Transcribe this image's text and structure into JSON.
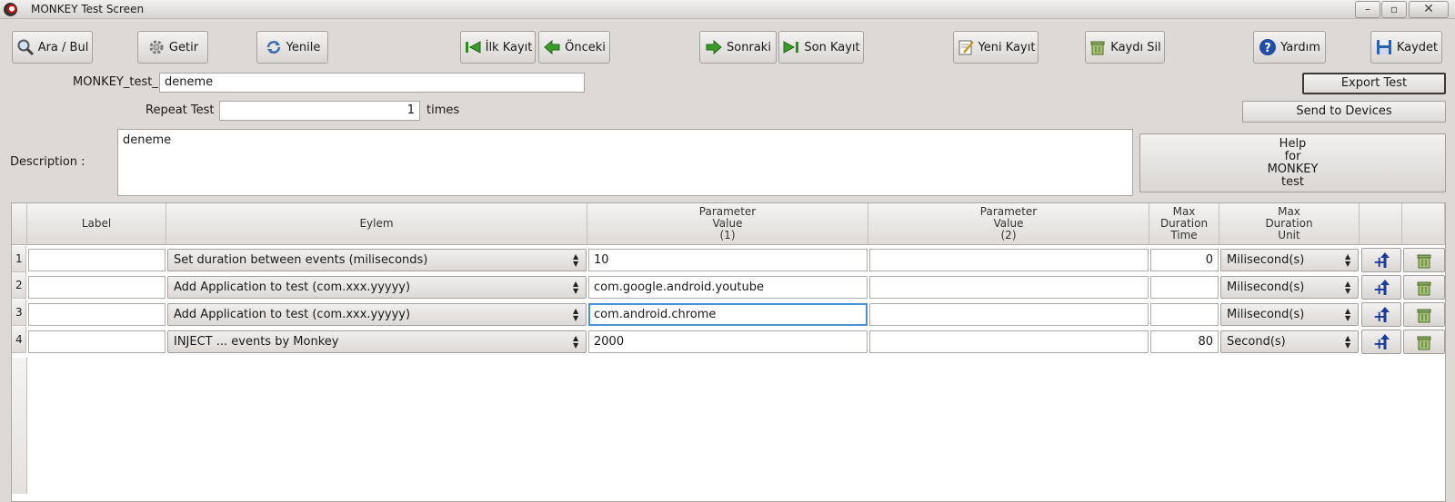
{
  "window": {
    "title": "MONKEY Test Screen",
    "minimize": "–",
    "restore": "▫",
    "close": "✕"
  },
  "toolbar": {
    "search_label": "Ara / Bul",
    "fetch_label": "Getir",
    "refresh_label": "Yenile",
    "first_label": "İlk Kayıt",
    "prev_label": "Önceki",
    "next_label": "Sonraki",
    "last_label": "Son Kayıt",
    "new_label": "Yeni Kayıt",
    "delete_label": "Kaydı Sil",
    "help_label": "Yardım",
    "save_label": "Kaydet"
  },
  "form": {
    "name_label": "MONKEY_test_",
    "name_value": "deneme",
    "repeat_label": "Repeat Test",
    "repeat_value": "1",
    "repeat_unit": "times",
    "description_label": "Description :",
    "description_value": "deneme",
    "export_label": "Export Test",
    "send_label": "Send to Devices",
    "help_lines": [
      "Help",
      "for",
      "MONKEY",
      "test"
    ]
  },
  "table": {
    "headers": {
      "label": "Label",
      "action": "Eylem",
      "param1": [
        "Parameter",
        "Value",
        "(1)"
      ],
      "param2": [
        "Parameter",
        "Value",
        "(2)"
      ],
      "max_time": [
        "Max",
        "Duration",
        "Time"
      ],
      "max_unit": [
        "Max",
        "Duration",
        "Unit"
      ]
    },
    "rows": [
      {
        "num": "1",
        "label": "",
        "action": "Set duration between events (miliseconds)",
        "param1": "10",
        "param2": "",
        "max_time": "0",
        "unit": "Milisecond(s)"
      },
      {
        "num": "2",
        "label": "",
        "action": "Add Application to test (com.xxx.yyyyy)",
        "param1": "com.google.android.youtube",
        "param2": "",
        "max_time": "",
        "unit": "Milisecond(s)"
      },
      {
        "num": "3",
        "label": "",
        "action": "Add Application to test (com.xxx.yyyyy)",
        "param1": "com.android.chrome",
        "param2": "",
        "max_time": "",
        "unit": "Milisecond(s)"
      },
      {
        "num": "4",
        "label": "",
        "action": "INJECT ... events by Monkey",
        "param1": "2000",
        "param2": "",
        "max_time": "80",
        "unit": "Second(s)"
      }
    ]
  },
  "icons": {
    "search": "magnifier-icon",
    "fetch": "gear-icon",
    "refresh": "refresh-icon",
    "first": "first-record-icon",
    "prev": "previous-icon",
    "next": "next-icon",
    "last": "last-record-icon",
    "new": "new-record-icon",
    "delete": "trash-icon",
    "help": "help-icon",
    "save": "floppy-icon",
    "insert_row": "insert-row-icon",
    "delete_row": "trash-icon"
  },
  "colors": {
    "accent_green": "#3a9a2a",
    "help_blue": "#1f4fa8",
    "focus_blue": "#4a90d9"
  }
}
